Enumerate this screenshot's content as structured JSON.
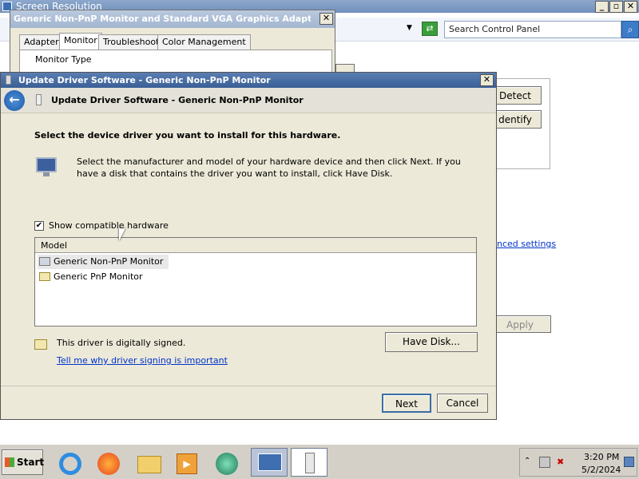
{
  "background_window": {
    "title": "Screen Resolution",
    "search_placeholder": "Search Control Panel",
    "detect_label": "Detect",
    "identify_label": "dentify",
    "advanced_link": "nced settings",
    "apply_label": "Apply"
  },
  "properties_window": {
    "title": "Generic Non-PnP Monitor and Standard VGA Graphics Adapter Pro...",
    "tabs": [
      {
        "label": "Adapter"
      },
      {
        "label": "Monitor"
      },
      {
        "label": "Troubleshoot"
      },
      {
        "label": "Color Management"
      }
    ],
    "group_label": "Monitor Type"
  },
  "dialog": {
    "title": "Update Driver Software - Generic Non-PnP Monitor",
    "header": "Update Driver Software - Generic Non-PnP Monitor",
    "heading": "Select the device driver you want to install for this hardware.",
    "description": "Select the manufacturer and model of your hardware device and then click Next. If you have a disk that contains the driver you want to install, click Have Disk.",
    "show_compatible_label": "Show compatible hardware",
    "show_compatible_checked": true,
    "list_header": "Model",
    "models": [
      {
        "label": "Generic Non-PnP Monitor",
        "selected": true
      },
      {
        "label": "Generic PnP Monitor",
        "selected": false
      }
    ],
    "signed_text": "This driver is digitally signed.",
    "signing_link": "Tell me why driver signing is important",
    "have_disk_label": "Have Disk...",
    "next_label": "Next",
    "cancel_label": "Cancel"
  },
  "taskbar": {
    "start_label": "Start",
    "time": "3:20 PM",
    "date": "5/2/2024",
    "colors": {
      "taskbar_bg": "#d4d0c8",
      "accent_blue": "#3a6ea5"
    }
  }
}
